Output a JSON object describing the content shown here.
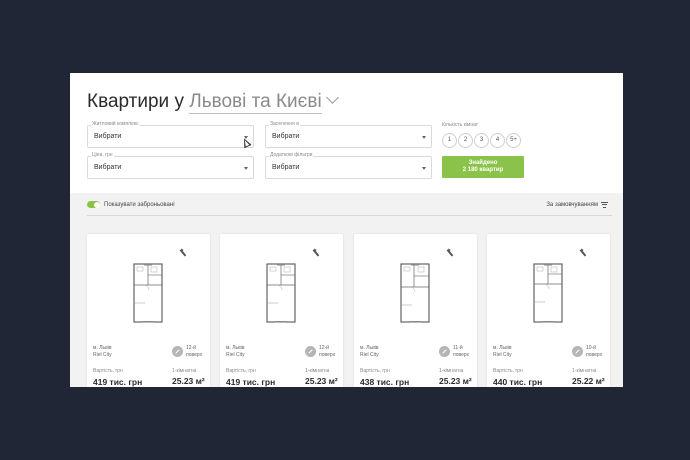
{
  "header": {
    "title_prefix": "Квартири у",
    "title_city": "Львові та Києві"
  },
  "filters": {
    "complex": {
      "label": "Житловий комплекс",
      "value": "Вибрати"
    },
    "settle": {
      "label": "Заселення в",
      "value": "Вибрати"
    },
    "price": {
      "label": "Ціна, грн",
      "value": "Вибрати"
    },
    "extra": {
      "label": "Додаткові фільтри",
      "value": "Вибрати"
    }
  },
  "rooms": {
    "label": "Кількість кімнат",
    "options": [
      "1",
      "2",
      "3",
      "4",
      "5+"
    ]
  },
  "found_button": {
    "line1": "Знайдено",
    "line2": "2 180 квартир"
  },
  "toolbar": {
    "show_reserved": "Показувати заброньовані",
    "sort": "За замовчуванням"
  },
  "cards": [
    {
      "city": "м. Львів",
      "complex": "Riel City",
      "floor1": "12-й",
      "floor2": "поверх",
      "cost_label": "Вартість, грн",
      "rooms_label": "1-кімнатна",
      "price": "419 тис. грн",
      "area": "25.23 м²"
    },
    {
      "city": "м. Львів",
      "complex": "Riel City",
      "floor1": "12-й",
      "floor2": "поверх",
      "cost_label": "Вартість, грн",
      "rooms_label": "1-кімнатна",
      "price": "419 тис. грн",
      "area": "25.23 м²"
    },
    {
      "city": "м. Львів",
      "complex": "Riel City",
      "floor1": "11-й",
      "floor2": "поверх",
      "cost_label": "Вартість, грн",
      "rooms_label": "1-кімнатна",
      "price": "438 тис. грн",
      "area": "25.23 м²"
    },
    {
      "city": "м. Львів",
      "complex": "Riel City",
      "floor1": "10-й",
      "floor2": "поверх",
      "cost_label": "Вартість, грн",
      "rooms_label": "1-кімнатна",
      "price": "440 тис. грн",
      "area": "25.22 м²"
    }
  ],
  "colors": {
    "accent": "#8bc34a",
    "background": "#212637"
  }
}
